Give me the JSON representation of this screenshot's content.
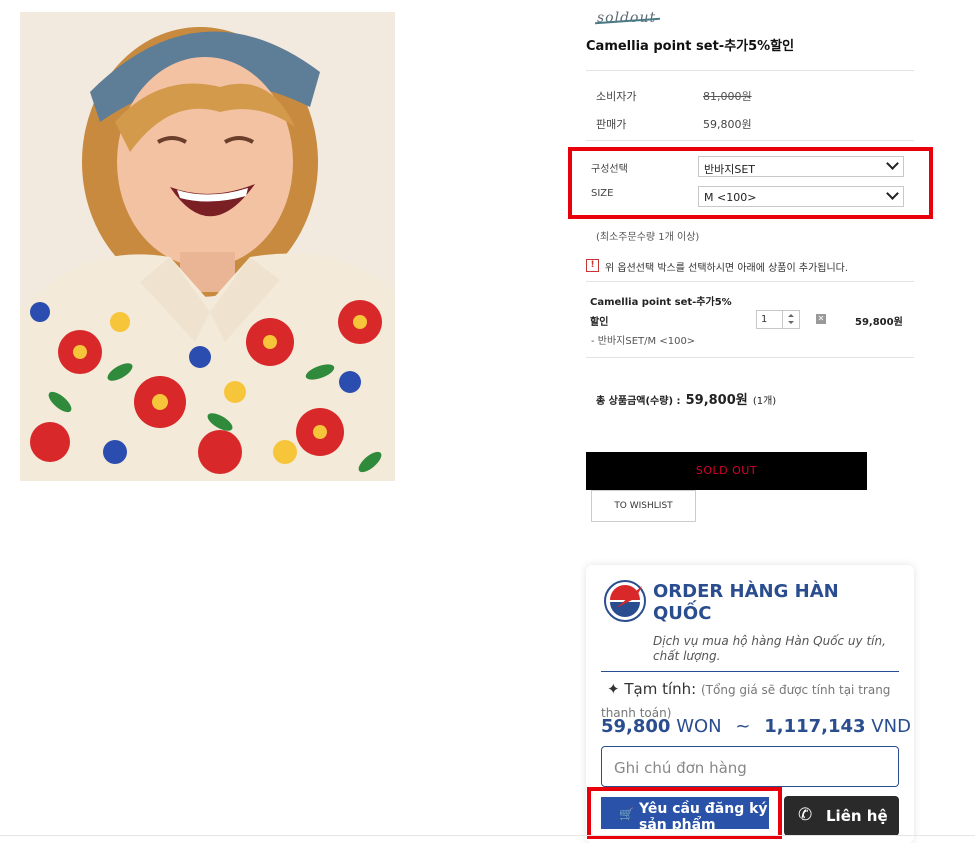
{
  "product": {
    "brand_mark": "soldout",
    "title": "Camellia point set-추가5%할인"
  },
  "prices": {
    "consumer_label": "소비자가",
    "consumer_value": "81,000원",
    "sale_label": "판매가",
    "sale_value": "59,800원"
  },
  "options": {
    "composition_label": "구성선택",
    "composition_value": "반바지SET",
    "size_label": "SIZE",
    "size_value": "M <100>",
    "min_order_note": "(최소주문수량 1개 이상)",
    "warning_text": "위 옵션선택 박스를 선택하시면 아래에 상품이 추가됩니다."
  },
  "selected_item": {
    "name_line1": "Camellia point set-추가5%",
    "name_line2": "할인",
    "option_line": "- 반바지SET/M <100>",
    "quantity": "1",
    "price": "59,800원"
  },
  "total": {
    "label": "총 상품금액(수량) :",
    "amount": "59,800원",
    "count": "(1개)"
  },
  "buttons": {
    "sold_out": "SOLD OUT",
    "wishlist": "TO WISHLIST"
  },
  "order_widget": {
    "title": "ORDER HÀNG HÀN QUỐC",
    "subtitle": "Dịch vụ mua hộ hàng Hàn Quốc uy tín, chất lượng.",
    "tam_tinh_label": "Tạm tính:",
    "tam_tinh_note": "(Tổng giá sẽ được tính tại trang thanh toán)",
    "price_won_value": "59,800",
    "price_won_unit": "WON",
    "tilde": "~",
    "price_vnd_value": "1,117,143",
    "price_vnd_unit": "VND",
    "note_placeholder": "Ghi chú đơn hàng",
    "request_button": "Yêu cầu đăng ký sản phẩm",
    "contact_button": "Liên hệ"
  },
  "colors": {
    "highlight_red": "#e8000b",
    "brand_blue": "#2a4d8f",
    "sold_out_text": "#d9002c"
  }
}
